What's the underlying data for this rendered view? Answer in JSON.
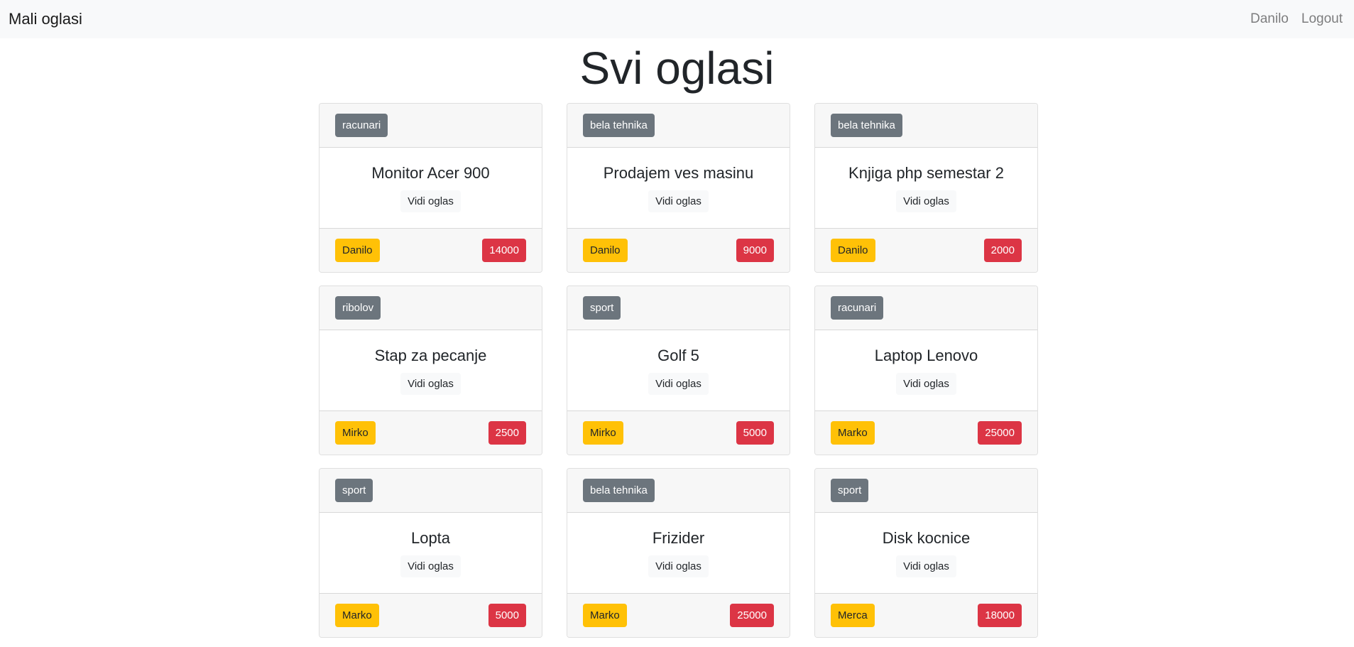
{
  "navbar": {
    "brand": "Mali oglasi",
    "user": "Danilo",
    "logout": "Logout"
  },
  "page": {
    "title": "Svi oglasi",
    "view_label": "Vidi oglas"
  },
  "colors": {
    "category_badge": "#6c757d",
    "user_badge": "#ffc107",
    "price_badge": "#dc3545"
  },
  "ads": [
    {
      "category": "racunari",
      "title": "Monitor Acer 900",
      "user": "Danilo",
      "price": "14000"
    },
    {
      "category": "bela tehnika",
      "title": "Prodajem ves masinu",
      "user": "Danilo",
      "price": "9000"
    },
    {
      "category": "bela tehnika",
      "title": "Knjiga php semestar 2",
      "user": "Danilo",
      "price": "2000"
    },
    {
      "category": "ribolov",
      "title": "Stap za pecanje",
      "user": "Mirko",
      "price": "2500"
    },
    {
      "category": "sport",
      "title": "Golf 5",
      "user": "Mirko",
      "price": "5000"
    },
    {
      "category": "racunari",
      "title": "Laptop Lenovo",
      "user": "Marko",
      "price": "25000"
    },
    {
      "category": "sport",
      "title": "Lopta",
      "user": "Marko",
      "price": "5000"
    },
    {
      "category": "bela tehnika",
      "title": "Frizider",
      "user": "Marko",
      "price": "25000"
    },
    {
      "category": "sport",
      "title": "Disk kocnice",
      "user": "Merca",
      "price": "18000"
    }
  ]
}
